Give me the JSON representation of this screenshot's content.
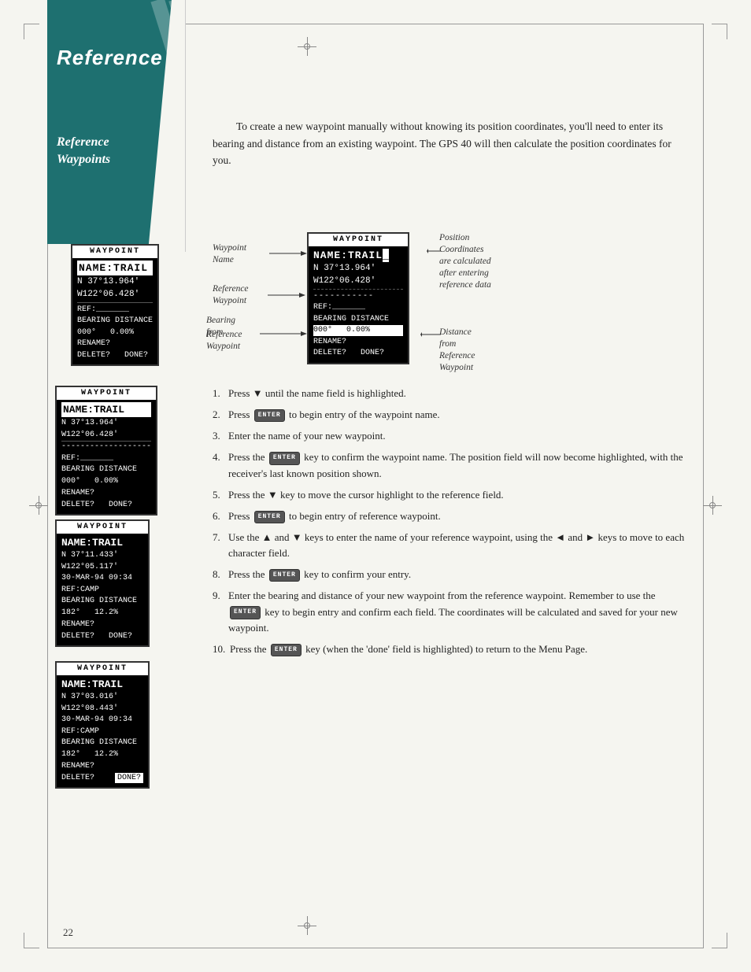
{
  "page": {
    "number": "22"
  },
  "sidebar": {
    "title": "Reference",
    "subtitle_line1": "Reference",
    "subtitle_line2": "Waypoints"
  },
  "intro": {
    "text": "To create a new waypoint manually without knowing its position coordinates, you'll need to enter its bearing and distance from an existing waypoint. The GPS 40 will then calculate the position coordinates for you."
  },
  "diagram": {
    "left_annotations": [
      {
        "label": "Waypoint\nName"
      },
      {
        "label": "Reference\nWaypoint"
      },
      {
        "label": "Bearing\nfrom\nReference\nWaypoint"
      }
    ],
    "right_annotations": [
      {
        "label": "Position\nCoordinates\nare calculated\nafter entering\nreference data"
      },
      {
        "label": "Distance\nfrom\nReference\nWaypoint"
      }
    ],
    "screen_top": {
      "title": "WAYPOINT",
      "lines": [
        "NAME:TRAIL",
        "N 37°13.964'",
        "W122°06.428'"
      ]
    },
    "screen_main": {
      "title": "WAYPOINT",
      "name_line": "NAME:TRAIL",
      "cursor": "_",
      "coord1": "N 37°13.964'",
      "coord2": "W122°06.428'",
      "ref_line": "REF:_______",
      "bearing_label": "BEARING DISTANCE",
      "bearing_val": "000°",
      "distance_val": "0.00%",
      "rename": "RENAME?",
      "delete": "DELETE?",
      "done": "DONE?"
    }
  },
  "left_screens": [
    {
      "title": "WAYPOINT",
      "lines": [
        "NAME: TRAIL",
        "N 37°13.964'",
        "W122°06.428'",
        "-------------------",
        "REF:_______",
        "BEARING DISTANCE",
        "000°    0.00%",
        "RENAME?",
        "DELETE?    DONE?"
      ]
    },
    {
      "title": "WAYPOINT",
      "lines": [
        "NAME: TRAIL",
        "N 37°11.433'",
        "W122°05.117'",
        "30-MAR-94 09:34",
        "REF:CAMP",
        "BEARING DISTANCE",
        "182°    12.2%",
        "RENAME?",
        "DELETE?    DONE?"
      ]
    },
    {
      "title": "WAYPOINT",
      "lines": [
        "NAME: TRAIL",
        "N 37°03.016'",
        "W122°08.443'",
        "30-MAR-94 09:34",
        "REF:CAMP",
        "BEARING DISTANCE",
        "182°    12.2%",
        "RENAME?",
        "DELETE?    DONE?"
      ]
    }
  ],
  "instructions": [
    {
      "number": 1,
      "text": "Press ▼ until the name field is highlighted."
    },
    {
      "number": 2,
      "text": "Press [ENTER] to begin entry of the waypoint name."
    },
    {
      "number": 3,
      "text": "Enter the name of your new waypoint."
    },
    {
      "number": 4,
      "text": "Press the [ENTER] key to confirm the waypoint name. The position field will now become highlighted, with the receiver's last known position shown."
    },
    {
      "number": 5,
      "text": "Press the ▼ key to move the cursor highlight to the reference field."
    },
    {
      "number": 6,
      "text": "Press [ENTER] to begin entry of reference waypoint."
    },
    {
      "number": 7,
      "text": "Use the ▲ and ▼ keys to enter the name of your reference waypoint, using the ◄ and ► keys to move to each character field."
    },
    {
      "number": 8,
      "text": "Press the [ENTER] key to confirm your entry."
    },
    {
      "number": 9,
      "text": "Enter the bearing and distance of your new waypoint from the reference waypoint. Remember to use the [ENTER] key to begin entry and confirm each field. The coordinates will be calculated and saved for your new waypoint."
    },
    {
      "number": 10,
      "text": "Press the [ENTER] key (when the 'done' field is highlighted) to return to the Menu Page."
    }
  ]
}
